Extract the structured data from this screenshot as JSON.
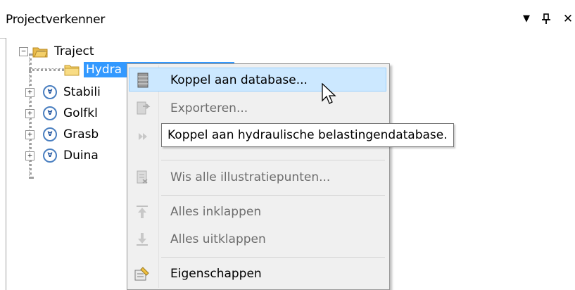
{
  "panel": {
    "title": "Projectverkenner",
    "dropdown_glyph": "▼",
    "pin_glyph": "ꟷ",
    "close_glyph": "✕"
  },
  "tree": {
    "root": {
      "label": "Traject",
      "expander": "−",
      "icon": "folder-open-icon"
    },
    "children": [
      {
        "label": "Hydraulische belastingen",
        "visible_label": "Hydra",
        "icon": "folder-icon",
        "selected": true
      },
      {
        "label": "Stabili",
        "expander": "+",
        "icon": "calculation-icon"
      },
      {
        "label": "Golfkl",
        "expander": "+",
        "icon": "calculation-icon"
      },
      {
        "label": "Grasb",
        "expander": "+",
        "icon": "calculation-icon"
      },
      {
        "label": "Duina",
        "expander": "+",
        "icon": "calculation-icon"
      }
    ]
  },
  "context_menu": {
    "items": [
      {
        "label": "Koppel aan database...",
        "icon": "database-icon",
        "enabled": true,
        "hover": true
      },
      {
        "label": "Exporteren...",
        "icon": "export-icon",
        "enabled": false
      },
      {
        "label": "",
        "icon": "run-icon",
        "enabled": false
      },
      {
        "label": "Wis alle illustratiepunten...",
        "icon": "clear-icon",
        "enabled": false
      },
      {
        "label": "Alles inklappen",
        "icon": "collapse-all-icon",
        "enabled": false
      },
      {
        "label": "Alles uitklappen",
        "icon": "expand-all-icon",
        "enabled": false
      },
      {
        "label": "Eigenschappen",
        "icon": "properties-icon",
        "enabled": true
      }
    ]
  },
  "tooltip": {
    "text": "Koppel aan hydraulische belastingendatabase."
  },
  "colors": {
    "selection": "#3399ff",
    "menu_hover": "#cce8ff",
    "menu_bg": "#f0f0f0"
  }
}
